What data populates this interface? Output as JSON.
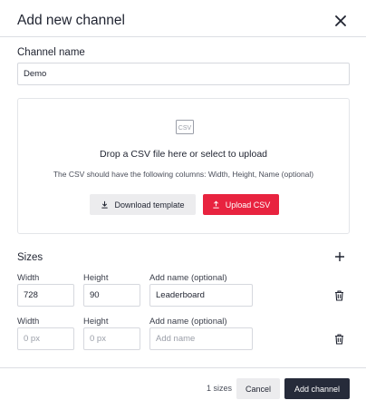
{
  "dialog": {
    "title": "Add new channel"
  },
  "channel": {
    "label": "Channel name",
    "value": "Demo"
  },
  "upload": {
    "icon_text": "CSV",
    "title": "Drop a CSV file here or select to upload",
    "subtitle": "The CSV should have the following columns: Width, Height, Name (optional)",
    "download_label": "Download template",
    "upload_label": "Upload CSV"
  },
  "sizes": {
    "label": "Sizes",
    "width_label": "Width",
    "height_label": "Height",
    "name_label": "Add name (optional)",
    "rows": [
      {
        "width": "728",
        "height": "90",
        "name": "Leaderboard"
      },
      {
        "width": "",
        "height": "",
        "name": ""
      }
    ],
    "width_placeholder": "0 px",
    "height_placeholder": "0 px",
    "name_placeholder": "Add name"
  },
  "footer": {
    "count": "1 sizes",
    "cancel_label": "Cancel",
    "add_label": "Add channel"
  },
  "colors": {
    "accent_red": "#e8233f",
    "primary_dark": "#262b3a"
  }
}
